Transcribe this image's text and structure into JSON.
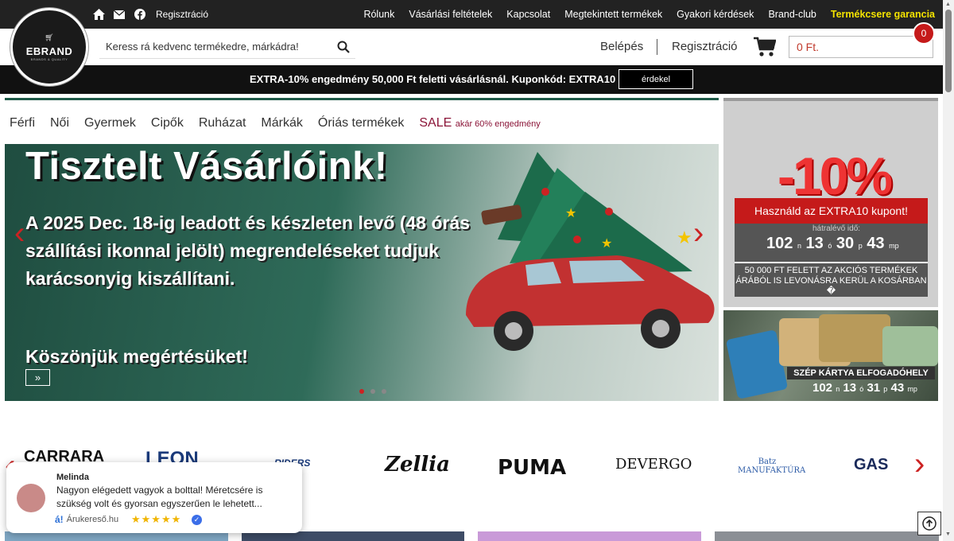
{
  "topbar": {
    "register_label": "Regisztráció",
    "links": [
      "Rólunk",
      "Vásárlási feltételek",
      "Kapcsolat",
      "Megtekintett termékek",
      "Gyakori kérdések",
      "Brand-club"
    ],
    "guarantee_label": "Termékcsere garancia"
  },
  "logo": {
    "brand": "EBRAND",
    "tagline": "BRANDS & QUALITY"
  },
  "header": {
    "search_placeholder": "Keress rá kedvenc termékedre, márkádra!",
    "login_label": "Belépés",
    "register_label": "Regisztráció",
    "cart_total": "0 Ft.",
    "cart_count": "0"
  },
  "promo": {
    "text": "EXTRA-10% engedmény 50,000 Ft feletti vásárlásnál. Kuponkód: EXTRA10",
    "button": "érdekel"
  },
  "nav": {
    "items": [
      "Férfi",
      "Női",
      "Gyermek",
      "Cipők",
      "Ruházat",
      "Márkák",
      "Óriás termékek"
    ],
    "sale_label": "SALE",
    "sale_note": "akár 60% engedmény"
  },
  "hero": {
    "title": "Tisztelt Vásárlóink!",
    "body": "A 2025 Dec. 18-ig leadott és készleten levő (48 órás szállítási ikonnal jelölt) megrendeléseket tudjuk karácsonyig kiszállítani.",
    "thanks": "Köszönjük megértésüket!",
    "more_label": "»",
    "slides_total": 3,
    "slide_active": 1
  },
  "side_banner_1": {
    "discount": "-10%",
    "coupon": "Használd az EXTRA10 kupont!",
    "time_label": "hátralévő idő:",
    "countdown": {
      "n": "102",
      "o": "13",
      "p": "30",
      "mp": "43"
    },
    "note": "50 000 FT FELETT AZ AKCIÓS TERMÉKEK ÁRÁBÓL IS LEVONÁSRA KERÜL A KOSÁRBAN �"
  },
  "side_banner_2": {
    "label": "SZÉP KÁRTYA ELFOGADÓHELY",
    "countdown": {
      "n": "102",
      "o": "13",
      "p": "31",
      "mp": "43"
    }
  },
  "brands": [
    "CARRARA",
    "LEON",
    "RIDERS",
    "Zellia",
    "PUMA",
    "DEVERGO",
    "Batz MANUFAKTÚRA",
    "GAS"
  ],
  "review": {
    "name": "Melinda",
    "message": "Nagyon elégedett vagyok a bolttal! Méretcsére is szükség volt és gyorsan egyszerűen le lehetett...",
    "source": "Árukereső.hu",
    "stars": "★★★★★",
    "rating": 5
  },
  "colors": {
    "accent_red": "#c51a1a",
    "hero_green": "#1f4d40",
    "guarantee_yellow": "#f4e300"
  }
}
